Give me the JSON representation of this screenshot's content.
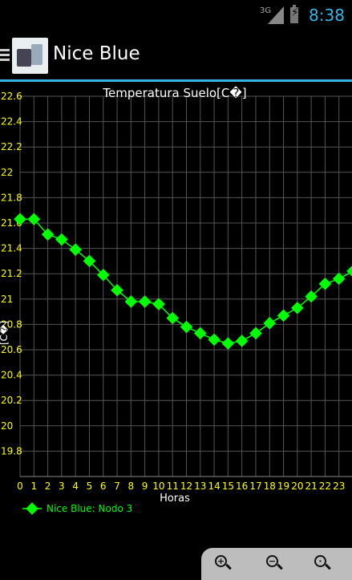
{
  "status_bar": {
    "network": "3G",
    "time": "8:38"
  },
  "action_bar": {
    "title": "Nice Blue"
  },
  "chart_data": {
    "type": "line",
    "title": "Temperatura Suelo[C�]",
    "xlabel": "Horas",
    "ylabel": "[C�]",
    "x": [
      0,
      1,
      2,
      3,
      4,
      5,
      6,
      7,
      8,
      9,
      10,
      11,
      12,
      13,
      14,
      15,
      16,
      17,
      18,
      19,
      20,
      21,
      22,
      23,
      24
    ],
    "xtick_labels": [
      "0",
      "1",
      "2",
      "3",
      "4",
      "5",
      "6",
      "7",
      "8",
      "9",
      "10",
      "11",
      "12",
      "13",
      "14",
      "15",
      "16",
      "17",
      "18",
      "19",
      "20",
      "21",
      "22",
      "23"
    ],
    "ytick_labels": [
      "19.8",
      "20",
      "20.2",
      "20.4",
      "20.6",
      "20.8",
      "21",
      "21.2",
      "21.4",
      "21.6",
      "21.8",
      "22",
      "22.2",
      "22.4",
      "22.6"
    ],
    "xlim": [
      0,
      24
    ],
    "ylim": [
      19.6,
      22.6
    ],
    "grid": true,
    "series": [
      {
        "name": "Nice Blue: Nodo 3",
        "color": "#00ff00",
        "values": [
          21.63,
          21.63,
          21.51,
          21.47,
          21.39,
          21.3,
          21.19,
          21.07,
          20.98,
          20.98,
          20.96,
          20.85,
          20.78,
          20.73,
          20.68,
          20.65,
          20.67,
          20.73,
          20.81,
          20.87,
          20.93,
          21.02,
          21.12,
          21.16,
          21.22
        ]
      }
    ],
    "colors": {
      "axis_text": "#ffff00",
      "grid": "#555555",
      "series": "#00ff00"
    }
  },
  "zoom_controls": {
    "zoom_in": "zoom-in-icon",
    "zoom_out": "zoom-out-icon",
    "zoom_reset": "zoom-reset-icon"
  }
}
